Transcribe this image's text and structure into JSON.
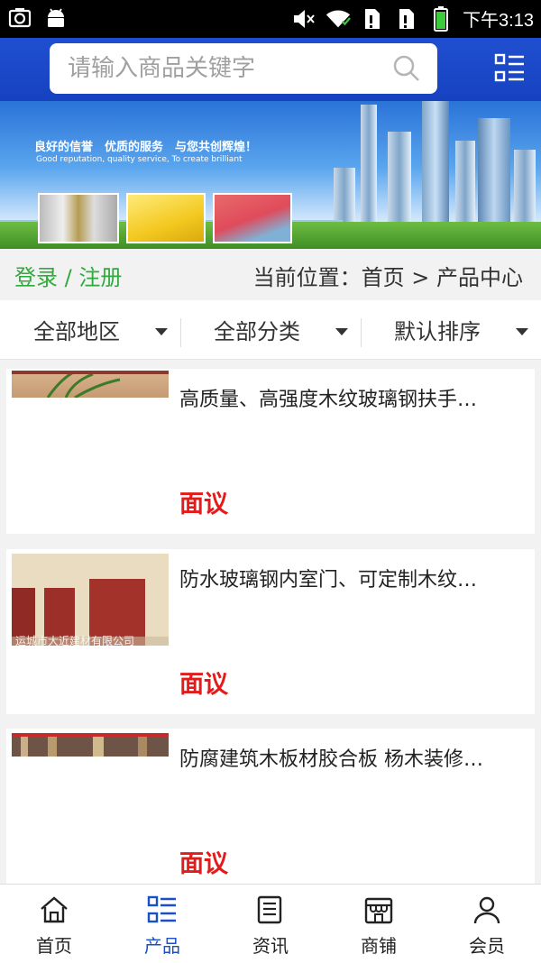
{
  "status_bar": {
    "time": "下午3:13",
    "left_icons": [
      "camera-icon",
      "android-icon"
    ],
    "right_icons": [
      "mute-icon",
      "wifi-icon",
      "sim1-icon",
      "sim2-icon",
      "battery-icon"
    ]
  },
  "header": {
    "search_placeholder": "请输入商品关键字",
    "accent_color": "#1f4fd0"
  },
  "banner": {
    "slogan": "良好的信誉　优质的服务　与您共创辉煌！",
    "slogan_en": "Good reputation,  quality service,  To create brilliant"
  },
  "location": {
    "login_text": "登录 / 注册",
    "breadcrumb": "当前位置：首页 > 产品中心"
  },
  "filters": [
    {
      "label": "全部地区"
    },
    {
      "label": "全部分类"
    },
    {
      "label": "默认排序"
    }
  ],
  "products": [
    {
      "title": "高质量、高强度木纹玻璃钢扶手…",
      "price": "面议"
    },
    {
      "title": "防水玻璃钢内室门、可定制木纹…",
      "price": "面议",
      "watermark": "运城市大近建材有限公司"
    },
    {
      "title": "防腐建筑木板材胶合板 杨木装修…",
      "price": "面议"
    }
  ],
  "tabs": [
    {
      "label": "首页",
      "icon": "home-icon",
      "active": false
    },
    {
      "label": "产品",
      "icon": "grid-list-icon",
      "active": true
    },
    {
      "label": "资讯",
      "icon": "news-icon",
      "active": false
    },
    {
      "label": "商铺",
      "icon": "store-icon",
      "active": false
    },
    {
      "label": "会员",
      "icon": "user-icon",
      "active": false
    }
  ]
}
